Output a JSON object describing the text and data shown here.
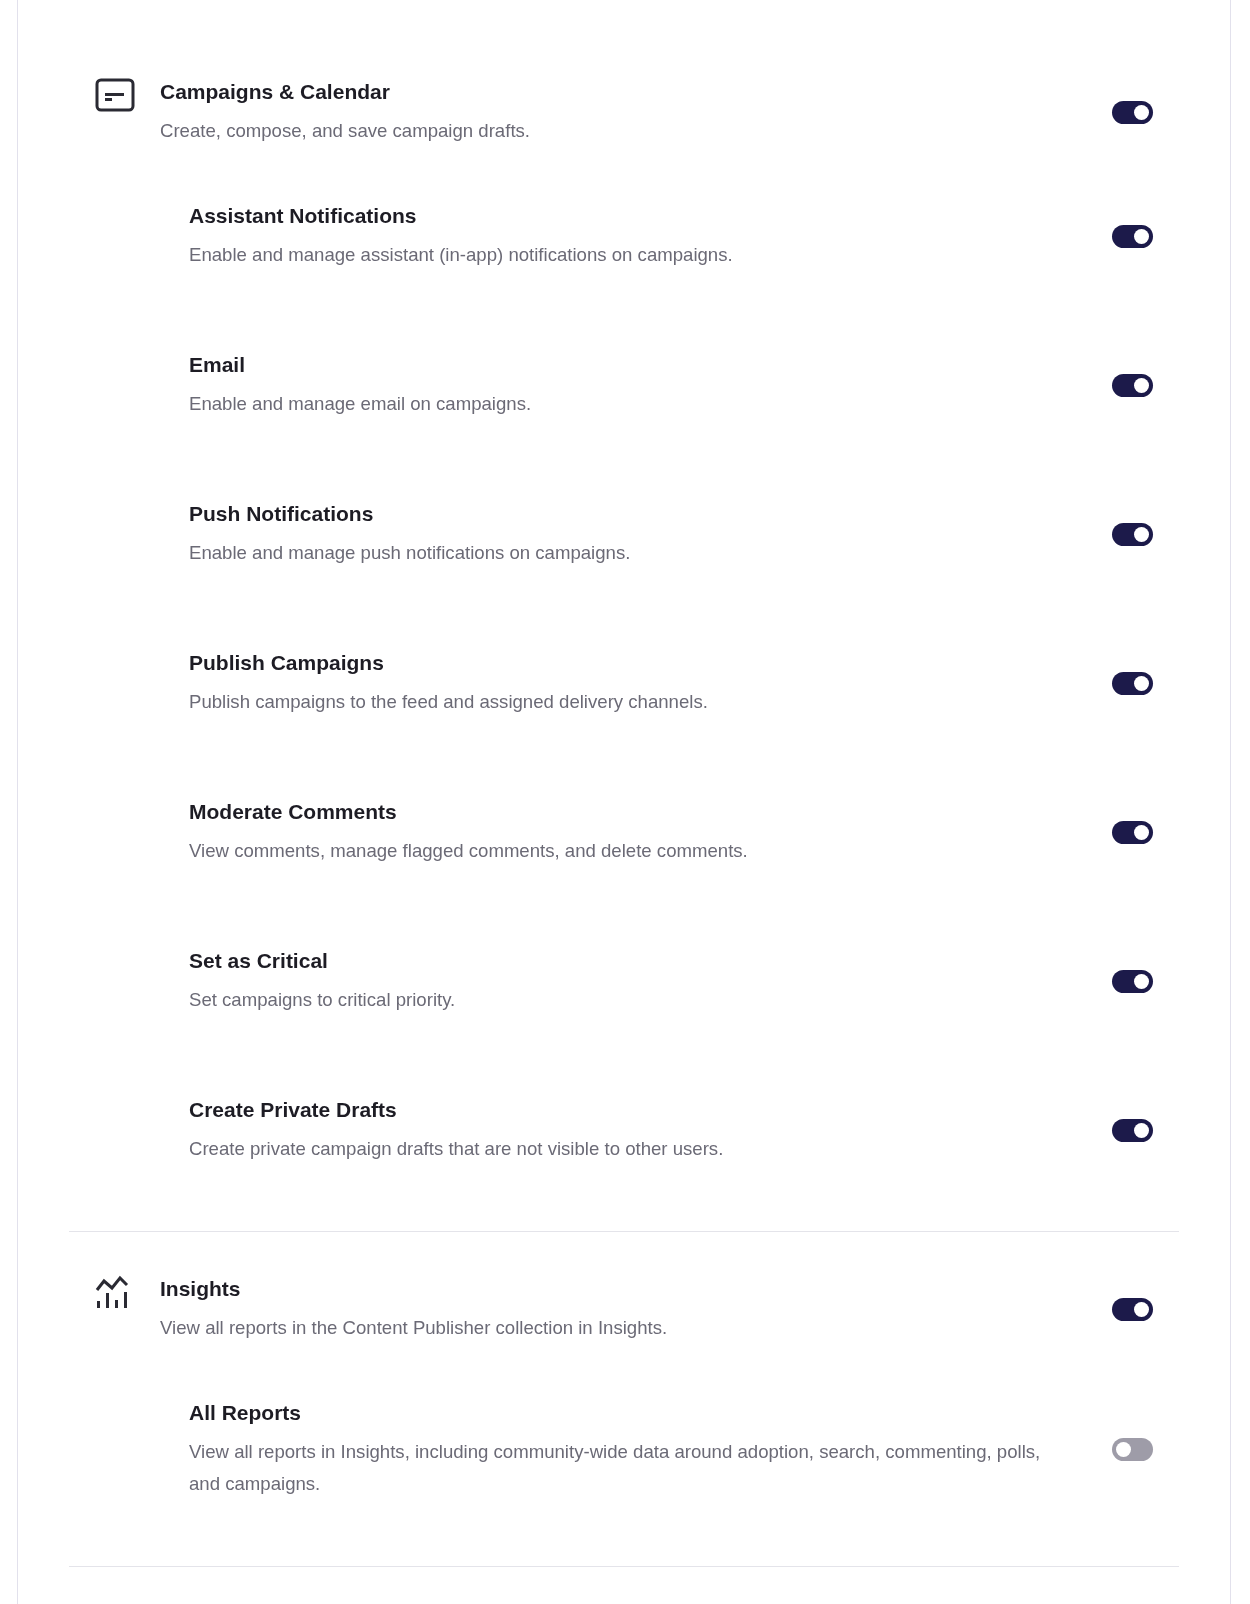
{
  "sections": [
    {
      "kind": "card",
      "title": "Campaigns & Calendar",
      "description": "Create, compose, and save campaign drafts.",
      "on": true,
      "items": [
        {
          "title": "Assistant Notifications",
          "description": "Enable and manage assistant (in-app) notifications on campaigns.",
          "on": true
        },
        {
          "title": "Email",
          "description": "Enable and manage email on campaigns.",
          "on": true
        },
        {
          "title": "Push Notifications",
          "description": "Enable and manage push notifications on campaigns.",
          "on": true
        },
        {
          "title": "Publish Campaigns",
          "description": "Publish campaigns to the feed and assigned delivery channels.",
          "on": true
        },
        {
          "title": "Moderate Comments",
          "description": "View comments, manage flagged comments, and delete comments.",
          "on": true
        },
        {
          "title": "Set as Critical",
          "description": "Set campaigns to critical priority.",
          "on": true
        },
        {
          "title": "Create Private Drafts",
          "description": "Create private campaign drafts that are not visible to other users.",
          "on": true
        }
      ]
    },
    {
      "kind": "chart",
      "title": "Insights",
      "description": "View all reports in the Content Publisher collection in Insights.",
      "on": true,
      "items": [
        {
          "title": "All Reports",
          "description": "View all reports in Insights, including community-wide data around adoption, search, commenting, polls, and campaigns.",
          "on": false
        }
      ]
    }
  ]
}
